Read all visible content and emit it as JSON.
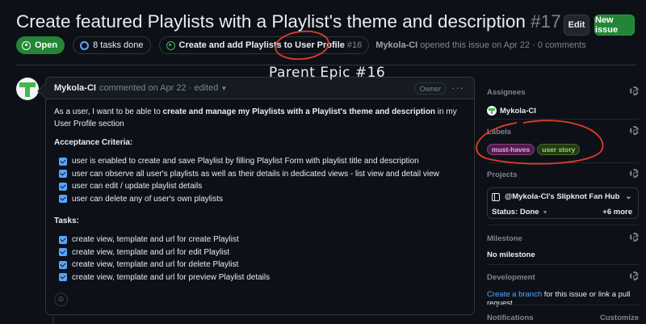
{
  "issue": {
    "title": "Create featured Playlists with a Playlist's theme and description",
    "number": "#17"
  },
  "header_buttons": {
    "edit": "Edit",
    "new_issue": "New issue"
  },
  "meta": {
    "state": "Open",
    "tasks_done": "8 tasks done",
    "parent_title": "Create and add Playlists to User Profile",
    "parent_number": "#16",
    "author": "Mykola-CI",
    "opened_text": "opened this issue on Apr 22 · 0 comments"
  },
  "annotation": {
    "text": "Parent Epic #16",
    "color": "#e03c2b"
  },
  "comment": {
    "author": "Mykola-CI",
    "meta": "commented on Apr 22 · edited",
    "badge": "Owner",
    "intro": {
      "part1": "As a user,",
      "part2": " I want to be able to ",
      "part3": "create and manage my Playlists with a Playlist's theme and description",
      "part4": " in my User Profile section"
    },
    "criteria_heading": "Acceptance Criteria:",
    "criteria": [
      "user is enabled to create and save Playlist by filling Playlist Form with playlist title and description",
      "user can observe all user's playlists as well as their details in dedicated views - list view and detail view",
      "user can edit / update playlist details",
      "user can delete any of user's own playlists"
    ],
    "tasks_heading": "Tasks:",
    "tasks": [
      "create view, template and url for create Playlist",
      "create view, template and url for edit Playlist",
      "create view, template and url for delete Playlist",
      "create view, template and url for preview Playlist details"
    ]
  },
  "sidebar": {
    "assignees": {
      "heading": "Assignees",
      "name": "Mykola-CI"
    },
    "labels": {
      "heading": "Labels",
      "items": [
        "must-haves",
        "user story"
      ]
    },
    "projects": {
      "heading": "Projects",
      "project": "@Mykola-CI's Slipknot Fan Hub",
      "status": "Status: Done",
      "more": "+6 more"
    },
    "milestone": {
      "heading": "Milestone",
      "value": "No milestone"
    },
    "development": {
      "heading": "Development",
      "link": "Create a branch",
      "rest": " for this issue or link a pull request."
    },
    "notifications": {
      "heading": "Notifications",
      "customize": "Customize"
    }
  },
  "colors": {
    "background": "#0d1117",
    "accent_green": "#238636",
    "link": "#58a6ff"
  }
}
